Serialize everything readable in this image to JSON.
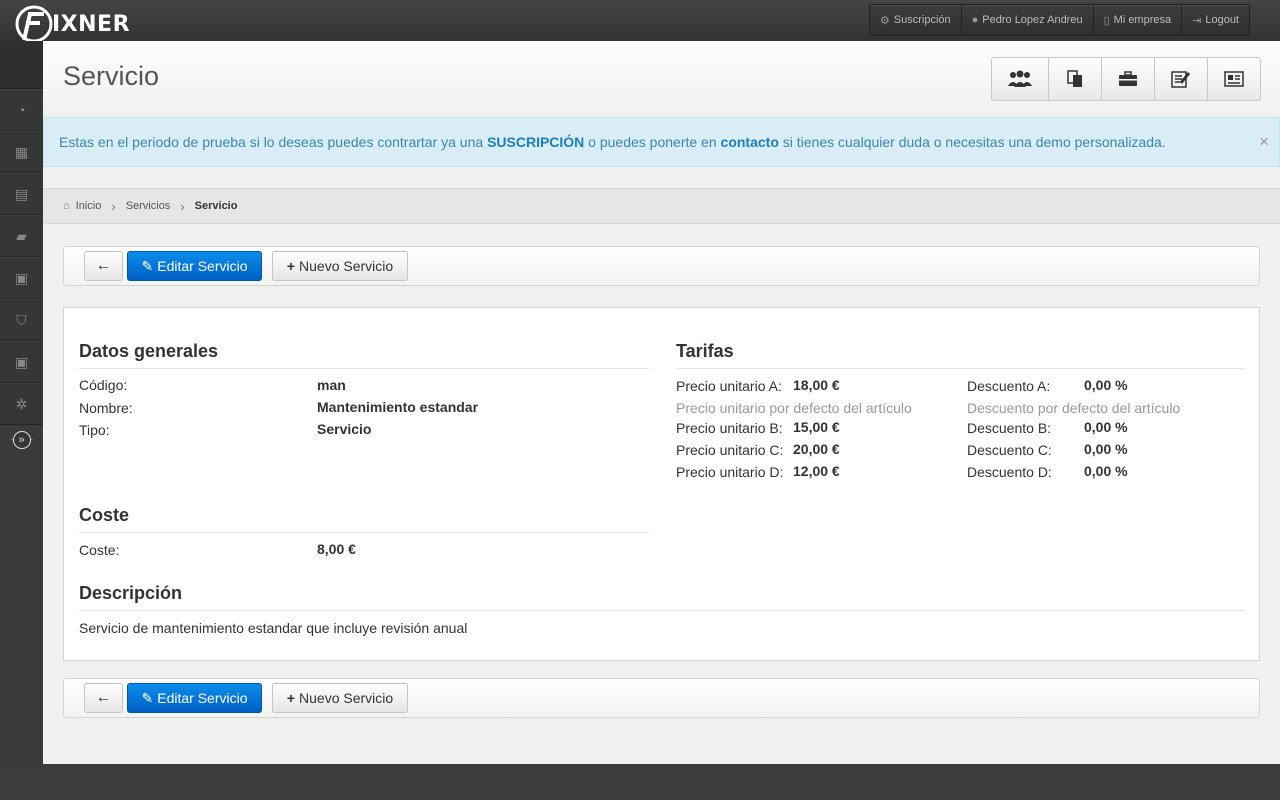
{
  "app": {
    "logo_text": "IXNER"
  },
  "topnav": [
    {
      "label": "Suscripción",
      "icon": "gear-icon"
    },
    {
      "label": "Pedro Lopez Andreu",
      "icon": "user-icon"
    },
    {
      "label": "Mi empresa",
      "icon": "building-icon"
    },
    {
      "label": "Logout",
      "icon": "logout-icon"
    }
  ],
  "sidebar": {
    "items": [
      {
        "icon": "dashboard-icon",
        "glyph": "◔"
      },
      {
        "icon": "calendar-icon",
        "glyph": "▦"
      },
      {
        "icon": "list-icon",
        "glyph": "▤"
      },
      {
        "icon": "folder-icon",
        "glyph": "▰"
      },
      {
        "icon": "money-icon",
        "glyph": "▣"
      },
      {
        "icon": "cart-icon",
        "glyph": "⛉"
      },
      {
        "icon": "money-icon-2",
        "glyph": "▣"
      },
      {
        "icon": "settings-icon",
        "glyph": "✲"
      }
    ]
  },
  "page": {
    "title": "Servicio"
  },
  "quick_buttons": [
    {
      "icon": "group-icon"
    },
    {
      "icon": "documents-icon"
    },
    {
      "icon": "briefcase-icon"
    },
    {
      "icon": "edit-note-icon"
    },
    {
      "icon": "contact-card-icon"
    }
  ],
  "alert": {
    "text_1": "Estas en el periodo de prueba si lo deseas puedes contrartar ya una ",
    "link_1": "SUSCRIPCIÓN",
    "text_2": " o puedes ponerte en ",
    "link_2": "contacto",
    "text_3": " si tienes cualquier duda o necesitas una demo personalizada.",
    "close": "×"
  },
  "breadcrumb": {
    "home": "Inicio",
    "level1": "Servicios",
    "current": "Servicio"
  },
  "toolbar": {
    "back": "←",
    "edit": "Editar Servicio",
    "new": "Nuevo Servicio"
  },
  "general": {
    "title": "Datos generales",
    "codigo_label": "Código:",
    "codigo": "man",
    "nombre_label": "Nombre:",
    "nombre": "Mantenimiento estandar",
    "tipo_label": "Tipo:",
    "tipo": "Servicio"
  },
  "coste": {
    "title": "Coste",
    "label": "Coste:",
    "value": "8,00 €"
  },
  "descripcion": {
    "title": "Descripción",
    "text": "Servicio de mantenimiento estandar que incluye revisión anual"
  },
  "tarifas": {
    "title": "Tarifas",
    "precio_a_label": "Precio unitario A:",
    "precio_a": "18,00 €",
    "precio_default": "Precio unitario por defecto del artículo",
    "precio_b_label": "Precio unitario B:",
    "precio_b": "15,00 €",
    "precio_c_label": "Precio unitario C:",
    "precio_c": "20,00 €",
    "precio_d_label": "Precio unitario D:",
    "precio_d": "12,00 €",
    "desc_a_label": "Descuento A:",
    "desc_a": "0,00 %",
    "desc_default": "Descuento por defecto del artículo",
    "desc_b_label": "Descuento B:",
    "desc_b": "0,00 %",
    "desc_c_label": "Descuento C:",
    "desc_c": "0,00 %",
    "desc_d_label": "Descuento D:",
    "desc_d": "0,00 %"
  }
}
